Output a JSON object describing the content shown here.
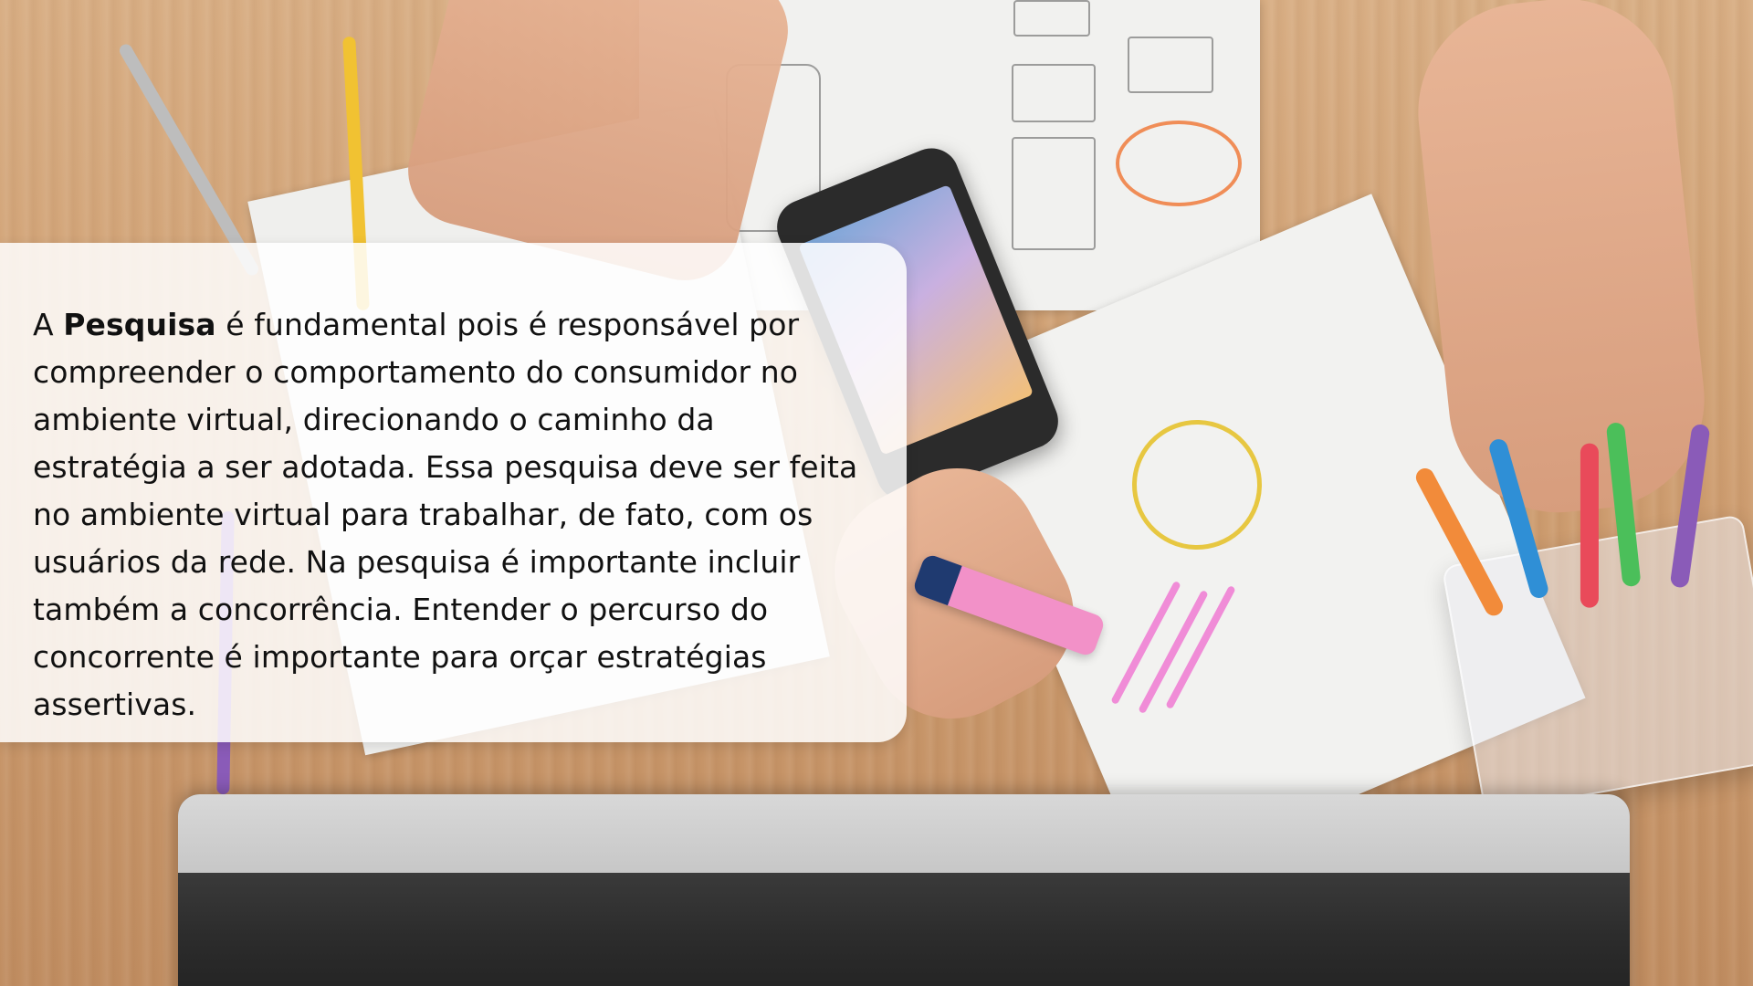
{
  "card": {
    "lead": "A ",
    "highlight": "Pesquisa",
    "body": "  é fundamental pois é responsável por compreender o comportamento do consumidor no ambiente virtual, direcionando o caminho da estratégia a ser adotada. Essa pesquisa deve ser feita no ambiente virtual para trabalhar, de fato, com os usuários da rede. Na pesquisa é importante incluir também a concorrência. Entender o percurso do concorrente é importante para orçar estratégias assertivas."
  }
}
